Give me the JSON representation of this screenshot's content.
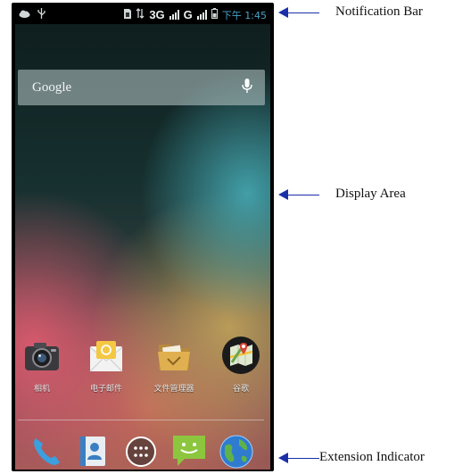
{
  "status_bar": {
    "network_3g": "3G",
    "network_g": "G",
    "clock": "下午 1:45"
  },
  "search": {
    "label": "Google"
  },
  "apps": [
    {
      "label": "相机",
      "icon": "camera-icon"
    },
    {
      "label": "电子邮件",
      "icon": "email-icon"
    },
    {
      "label": "文件管理器",
      "icon": "folder-icon"
    },
    {
      "label": "谷歌",
      "icon": "maps-icon"
    }
  ],
  "dock": [
    {
      "icon": "phone-icon"
    },
    {
      "icon": "contacts-icon"
    },
    {
      "icon": "app-drawer-icon"
    },
    {
      "icon": "messaging-icon"
    },
    {
      "icon": "browser-icon"
    }
  ],
  "annotations": {
    "notification_bar": "Notification Bar",
    "display_area": "Display Area",
    "extension_indicator": "Extension Indicator"
  },
  "colors": {
    "annotation_arrow": "#1b2fa8",
    "clock_text": "#4aa3c8"
  }
}
